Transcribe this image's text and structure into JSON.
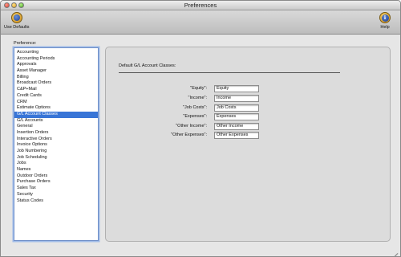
{
  "window": {
    "title": "Preferences"
  },
  "toolbar": {
    "use_defaults_label": "Use Defaults",
    "help_label": "Help",
    "help_glyph": "i"
  },
  "sidebar": {
    "label": "Preference:",
    "selected": "G/L Account Classes",
    "items": [
      "Accounting",
      "Accounting Periods",
      "Approvals",
      "Asset Manager",
      "Billing",
      "Broadcast Orders",
      "C&P+Mail",
      "Credit Cards",
      "CRM",
      "Estimate Options",
      "G/L Account Classes",
      "G/L Accounts",
      "General",
      "Insertion Orders",
      "Interactive Orders",
      "Invoice Options",
      "Job Numbering",
      "Job Scheduling",
      "Jobs",
      "Names",
      "Outdoor Orders",
      "Purchase Orders",
      "Sales Tax",
      "Security",
      "Status Codes"
    ]
  },
  "panel": {
    "section_title": "Default G/L Account Classes:",
    "fields": [
      {
        "label": "\"Equity\":",
        "value": "Equity"
      },
      {
        "label": "\"Income\":",
        "value": "Income"
      },
      {
        "label": "\"Job Costs\":",
        "value": "Job Costs"
      },
      {
        "label": "\"Expenses\":",
        "value": "Expenses"
      },
      {
        "label": "\"Other Income\":",
        "value": "Other Income"
      },
      {
        "label": "\"Other Expenses\":",
        "value": "Other Expenses"
      }
    ]
  },
  "colors": {
    "selection": "#3875d7",
    "list_focus": "#9fbbe8"
  },
  "icons": {
    "use_defaults": "gold-globe-icon",
    "help": "info-icon"
  }
}
